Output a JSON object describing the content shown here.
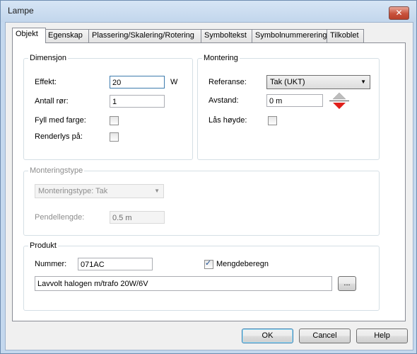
{
  "window": {
    "title": "Lampe",
    "close_label": "✕"
  },
  "tabs": [
    {
      "label": "Objekt",
      "active": true
    },
    {
      "label": "Egenskap"
    },
    {
      "label": "Plassering/Skalering/Rotering"
    },
    {
      "label": "Symboltekst"
    },
    {
      "label": "Symbolnummerering"
    },
    {
      "label": "Tilkoblet"
    }
  ],
  "dimensjon": {
    "legend": "Dimensjon",
    "effekt_label": "Effekt:",
    "effekt_value": "20",
    "effekt_unit": "W",
    "antall_label": "Antall rør:",
    "antall_value": "1",
    "fyll_label": "Fyll med farge:",
    "renderlys_label": "Renderlys på:"
  },
  "montering": {
    "legend": "Montering",
    "referanse_label": "Referanse:",
    "referanse_value": "Tak (UKT)",
    "avstand_label": "Avstand:",
    "avstand_value": "0 m",
    "laas_label": "Lås høyde:"
  },
  "monteringstype": {
    "legend": "Monteringstype",
    "select_value": "Monteringstype: Tak",
    "pendel_label": "Pendellengde:",
    "pendel_value": "0.5 m"
  },
  "produkt": {
    "legend": "Produkt",
    "nummer_label": "Nummer:",
    "nummer_value": "071AC",
    "mengde_label": "Mengdeberegn",
    "beskrivelse": "Lavvolt halogen m/trafo  20W/6V",
    "browse_label": "..."
  },
  "footer": {
    "ok": "OK",
    "cancel": "Cancel",
    "help": "Help"
  },
  "colors": {
    "accent": "#3c7fb1",
    "close": "#c8523c",
    "arrow": "#e0201b"
  }
}
